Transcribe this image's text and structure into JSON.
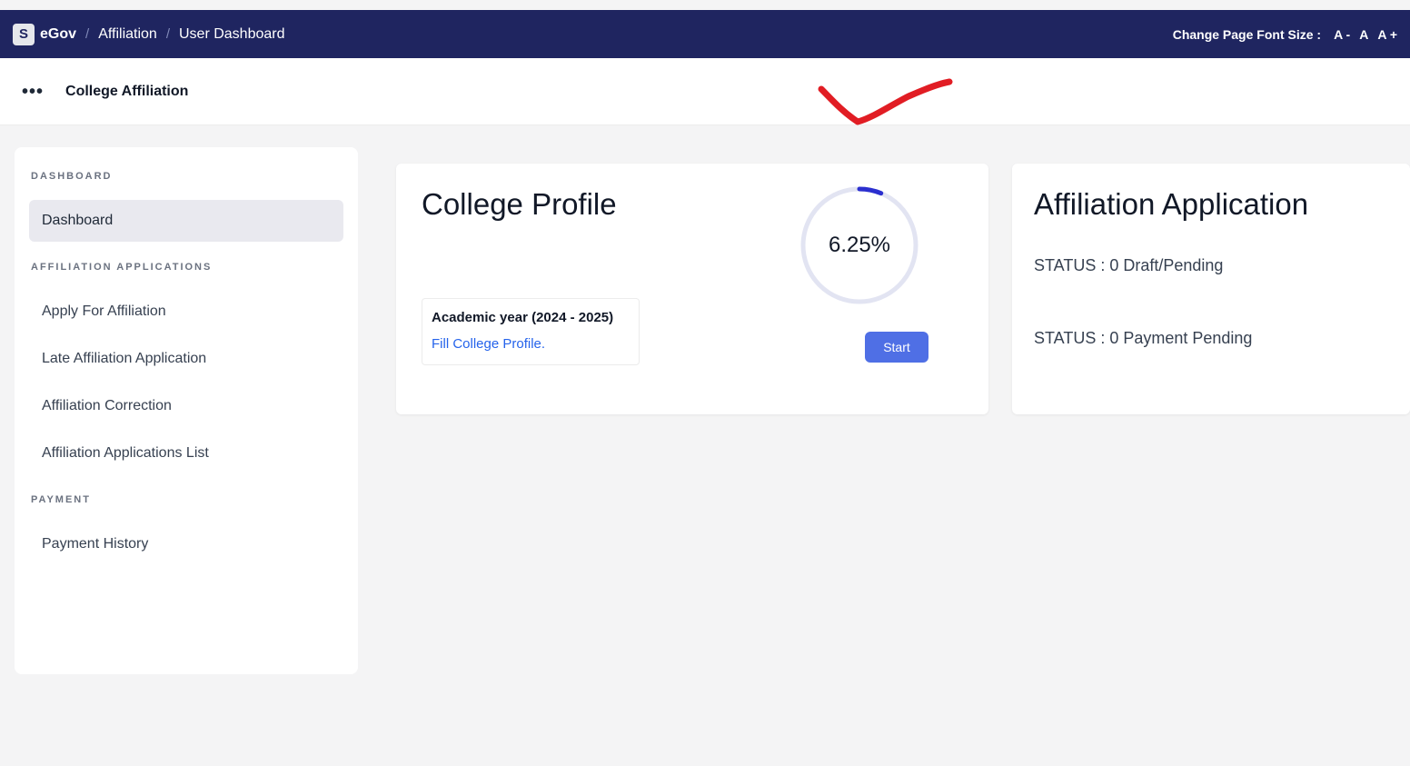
{
  "topbar": {
    "logo_letter": "S",
    "brand": "eGov",
    "breadcrumb": [
      "Affiliation",
      "User Dashboard"
    ],
    "separator": "/",
    "font_size_label": "Change Page Font Size :",
    "font_decrease": "A -",
    "font_normal": "A",
    "font_increase": "A +"
  },
  "subheader": {
    "menu_dots": "•••",
    "title": "College Affiliation"
  },
  "sidebar": {
    "sections": [
      {
        "title": "DASHBOARD",
        "items": [
          "Dashboard"
        ]
      },
      {
        "title": "AFFILIATION APPLICATIONS",
        "items": [
          "Apply For Affiliation",
          "Late Affiliation Application",
          "Affiliation Correction",
          "Affiliation Applications List"
        ]
      },
      {
        "title": "PAYMENT",
        "items": [
          "Payment History"
        ]
      }
    ],
    "active_item": "Dashboard"
  },
  "college_profile": {
    "title": "College Profile",
    "progress_percent": 6.25,
    "progress_label": "6.25%",
    "academic_year_label": "Academic year (2024 - 2025)",
    "fill_link": "Fill College Profile.",
    "start_button": "Start"
  },
  "affiliation_application": {
    "title": "Affiliation Application",
    "status_draft": "STATUS : 0 Draft/Pending",
    "status_payment": "STATUS : 0 Payment Pending"
  },
  "colors": {
    "topbar": "#1f2560",
    "accent": "#4f6fe5",
    "link": "#2563eb",
    "annotation": "#e11d24"
  }
}
